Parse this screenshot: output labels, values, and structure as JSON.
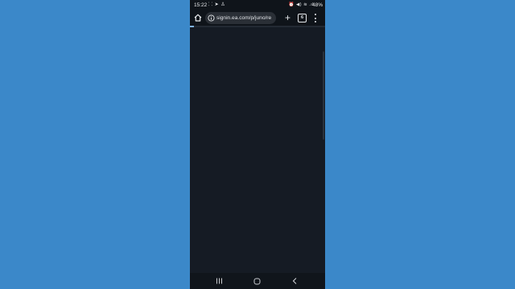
{
  "status_bar": {
    "time": "15:22",
    "left_icons": "⸬ ➤ ♙",
    "right_icons": "⏰ ◀) ≋ .ıl",
    "battery": "48%"
  },
  "browser": {
    "url": "signin.ea.com/p/juno/re",
    "tab_count": "6",
    "load_progress": 0.03
  },
  "colors": {
    "background": "#3b88c9",
    "page": "#151b24",
    "toolbar": "#0f141a",
    "progress": "#7fb2ea"
  },
  "icons": [
    "home-icon",
    "info-icon",
    "new-tab-icon",
    "tab-switcher-icon",
    "more-menu-icon",
    "nav-recents-icon",
    "nav-home-icon",
    "nav-back-icon"
  ]
}
